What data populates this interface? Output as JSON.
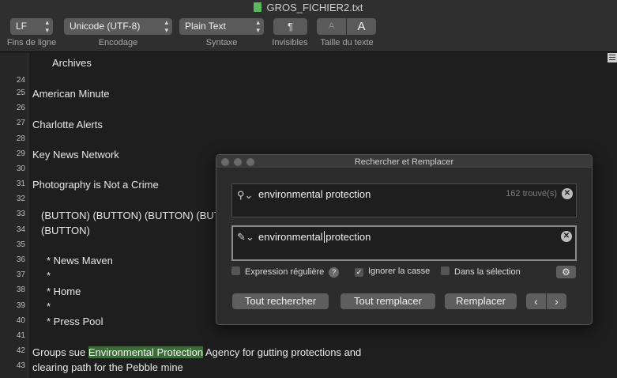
{
  "window": {
    "title": "GROS_FICHIER2.txt"
  },
  "toolbar": {
    "line_endings": {
      "value": "LF",
      "label": "Fins de ligne"
    },
    "encoding": {
      "value": "Unicode (UTF-8)",
      "label": "Encodage"
    },
    "syntax": {
      "value": "Plain Text",
      "label": "Syntaxe"
    },
    "invisibles": {
      "glyph": "¶",
      "label": "Invisibles"
    },
    "text_size": {
      "smaller": "A",
      "larger": "A",
      "label": "Taille du texte"
    }
  },
  "editor": {
    "lines": [
      {
        "num": "",
        "text": "Archives"
      },
      {
        "num": "24",
        "text": ""
      },
      {
        "num": "25",
        "text": "American Minute"
      },
      {
        "num": "26",
        "text": ""
      },
      {
        "num": "27",
        "text": "Charlotte Alerts"
      },
      {
        "num": "28",
        "text": ""
      },
      {
        "num": "29",
        "text": "Key News Network"
      },
      {
        "num": "30",
        "text": ""
      },
      {
        "num": "31",
        "text": "Photography is Not a Crime"
      },
      {
        "num": "32",
        "text": ""
      },
      {
        "num": "33",
        "text": "(BUTTON) (BUTTON) (BUTTON) (BUT"
      },
      {
        "num": "34",
        "text": "(BUTTON)"
      },
      {
        "num": "35",
        "text": ""
      },
      {
        "num": "36",
        "text": "* News Maven"
      },
      {
        "num": "37",
        "text": "*"
      },
      {
        "num": "38",
        "text": "* Home"
      },
      {
        "num": "39",
        "text": "*"
      },
      {
        "num": "40",
        "text": "* Press Pool"
      },
      {
        "num": "41",
        "text": ""
      },
      {
        "num": "42",
        "text_before": "Groups sue ",
        "highlight": "Environmental Protection",
        "text_after": " Agency for gutting protections and"
      },
      {
        "num": "43",
        "text": "clearing path for the Pebble mine"
      }
    ]
  },
  "find_panel": {
    "title": "Rechercher et Remplacer",
    "search": {
      "value": "environmental protection",
      "count": "162 trouvé(s)"
    },
    "replace": {
      "value_before": "environmental ",
      "value_after": "protection"
    },
    "options": {
      "regex": {
        "label": "Expression régulière",
        "checked": false
      },
      "ignore_case": {
        "label": "Ignorer la casse",
        "checked": true
      },
      "in_selection": {
        "label": "Dans la sélection",
        "checked": false
      }
    },
    "buttons": {
      "find_all": "Tout rechercher",
      "replace_all": "Tout remplacer",
      "replace": "Remplacer",
      "prev": "‹",
      "next": "›"
    }
  }
}
